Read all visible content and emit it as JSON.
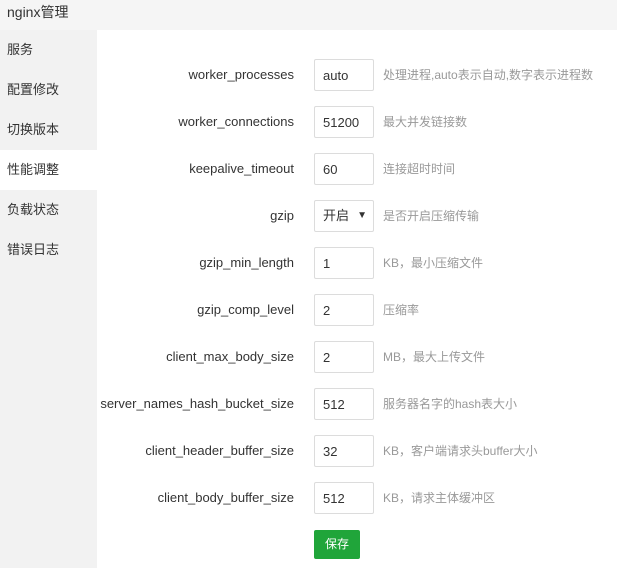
{
  "window": {
    "title": "nginx管理"
  },
  "sidebar": {
    "items": [
      {
        "label": "服务"
      },
      {
        "label": "配置修改"
      },
      {
        "label": "切换版本"
      },
      {
        "label": "性能调整",
        "active": true
      },
      {
        "label": "负载状态"
      },
      {
        "label": "错误日志"
      }
    ]
  },
  "form": {
    "rows": [
      {
        "label": "worker_processes",
        "value": "auto",
        "hint": "处理进程,auto表示自动,数字表示进程数"
      },
      {
        "label": "worker_connections",
        "value": "51200",
        "hint": "最大并发链接数"
      },
      {
        "label": "keepalive_timeout",
        "value": "60",
        "hint": "连接超时时间"
      },
      {
        "label": "gzip",
        "value": "开启",
        "hint": "是否开启压缩传输",
        "type": "select"
      },
      {
        "label": "gzip_min_length",
        "value": "1",
        "hint": "KB，最小压缩文件"
      },
      {
        "label": "gzip_comp_level",
        "value": "2",
        "hint": "压缩率"
      },
      {
        "label": "client_max_body_size",
        "value": "2",
        "hint": "MB，最大上传文件"
      },
      {
        "label": "server_names_hash_bucket_size",
        "value": "512",
        "hint": "服务器名字的hash表大小"
      },
      {
        "label": "client_header_buffer_size",
        "value": "32",
        "hint": "KB，客户端请求头buffer大小"
      },
      {
        "label": "client_body_buffer_size",
        "value": "512",
        "hint": "KB，请求主体缓冲区"
      }
    ],
    "save_label": "保存"
  },
  "colors": {
    "accent": "#20a53a",
    "sidebar_bg": "#f2f2f2",
    "hint": "#999999"
  }
}
